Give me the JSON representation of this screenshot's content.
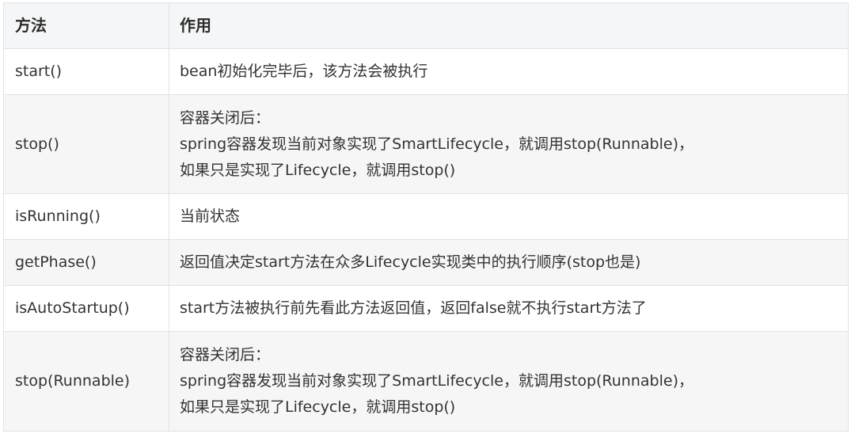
{
  "table": {
    "headers": {
      "method": "方法",
      "effect": "作用"
    },
    "rows": [
      {
        "method": "start()",
        "effect": [
          "bean初始化完毕后，该方法会被执行"
        ]
      },
      {
        "method": "stop()",
        "effect": [
          "容器关闭后：",
          "spring容器发现当前对象实现了SmartLifecycle，就调用stop(Runnable)，",
          "如果只是实现了Lifecycle，就调用stop()"
        ]
      },
      {
        "method": "isRunning()",
        "effect": [
          "当前状态"
        ]
      },
      {
        "method": "getPhase()",
        "effect": [
          "返回值决定start方法在众多Lifecycle实现类中的执行顺序(stop也是)"
        ]
      },
      {
        "method": "isAutoStartup()",
        "effect": [
          "start方法被执行前先看此方法返回值，返回false就不执行start方法了"
        ]
      },
      {
        "method": "stop(Runnable)",
        "effect": [
          "容器关闭后：",
          "spring容器发现当前对象实现了SmartLifecycle，就调用stop(Runnable)，",
          "如果只是实现了Lifecycle，就调用stop()"
        ]
      }
    ]
  }
}
